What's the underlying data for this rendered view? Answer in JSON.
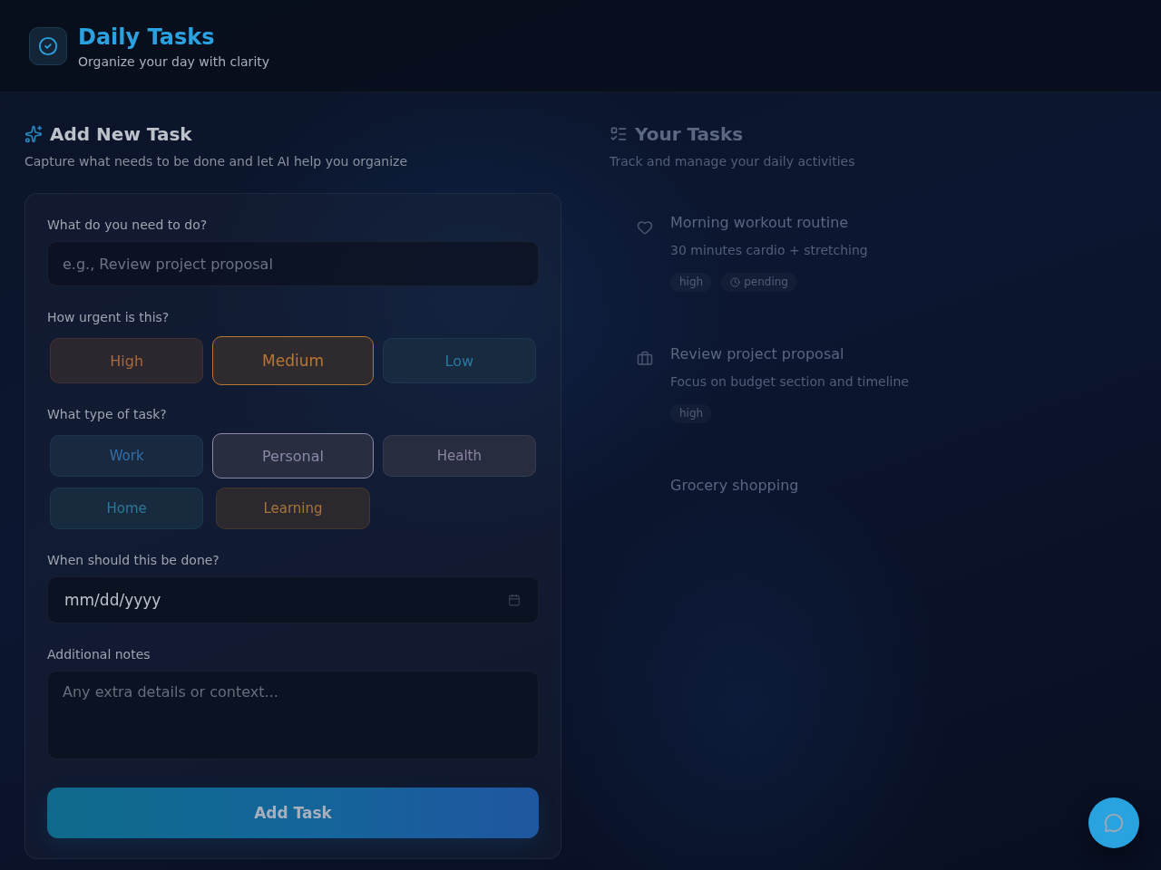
{
  "header": {
    "title": "Daily Tasks",
    "subtitle": "Organize your day with clarity"
  },
  "add_task": {
    "title": "Add New Task",
    "subtitle": "Capture what needs to be done and let AI help you organize",
    "task_field": {
      "label": "What do you need to do?",
      "placeholder": "e.g., Review project proposal"
    },
    "urgency": {
      "label": "How urgent is this?",
      "options": [
        {
          "label": "High",
          "selected": false,
          "color": "#a8693a"
        },
        {
          "label": "Medium",
          "selected": true,
          "color": "#b87834"
        },
        {
          "label": "Low",
          "selected": false,
          "color": "#2a78a0"
        }
      ]
    },
    "task_type": {
      "label": "What type of task?",
      "options": [
        {
          "label": "Work",
          "selected": false,
          "color": "#3571a8"
        },
        {
          "label": "Personal",
          "selected": true,
          "color": "#8c88a8"
        },
        {
          "label": "Health",
          "selected": false,
          "color": "#8a84a2"
        },
        {
          "label": "Home",
          "selected": false,
          "color": "#2c789a"
        },
        {
          "label": "Learning",
          "selected": false,
          "color": "#a8743a"
        }
      ]
    },
    "due_date": {
      "label": "When should this be done?",
      "placeholder": "mm/dd/yyyy"
    },
    "notes": {
      "label": "Additional notes",
      "placeholder": "Any extra details or context..."
    },
    "submit_button": "Add Task"
  },
  "task_list": {
    "title": "Your Tasks",
    "subtitle": "Track and manage your daily activities",
    "tasks": [
      {
        "kind": "health",
        "title": "Morning workout routine",
        "description": "30 minutes cardio + stretching",
        "tags": [
          {
            "kind": "priority",
            "label": "high"
          },
          {
            "kind": "status",
            "label": "pending"
          }
        ]
      },
      {
        "kind": "work",
        "title": "Review project proposal",
        "description": "Focus on budget section and timeline",
        "tags": [
          {
            "kind": "priority",
            "label": "high"
          }
        ]
      },
      {
        "title": "Grocery shopping"
      }
    ]
  }
}
